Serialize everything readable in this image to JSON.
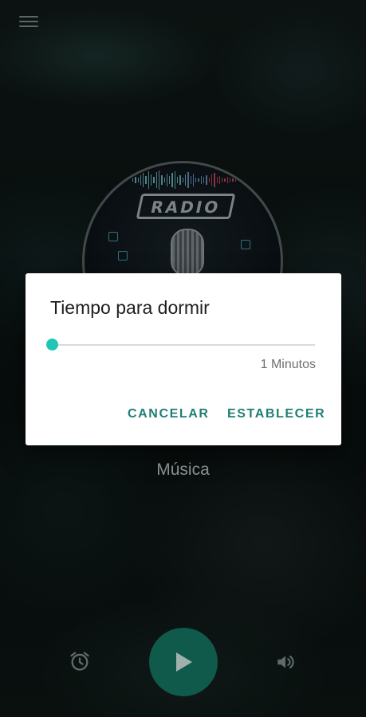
{
  "station": {
    "logo_text": "RADIO",
    "name": "Música"
  },
  "dialog": {
    "title": "Tiempo para dormir",
    "slider_value": 1,
    "slider_label": "1 Minutos",
    "cancel_label": "CANCELAR",
    "set_label": "ESTABLECER"
  },
  "player": {
    "alarm_icon": "alarm-clock-icon",
    "play_icon": "play-icon",
    "volume_icon": "volume-icon"
  },
  "colors": {
    "accent": "#1fc6b4",
    "button_text": "#1f7f74",
    "play_button": "#0f5a4b"
  }
}
